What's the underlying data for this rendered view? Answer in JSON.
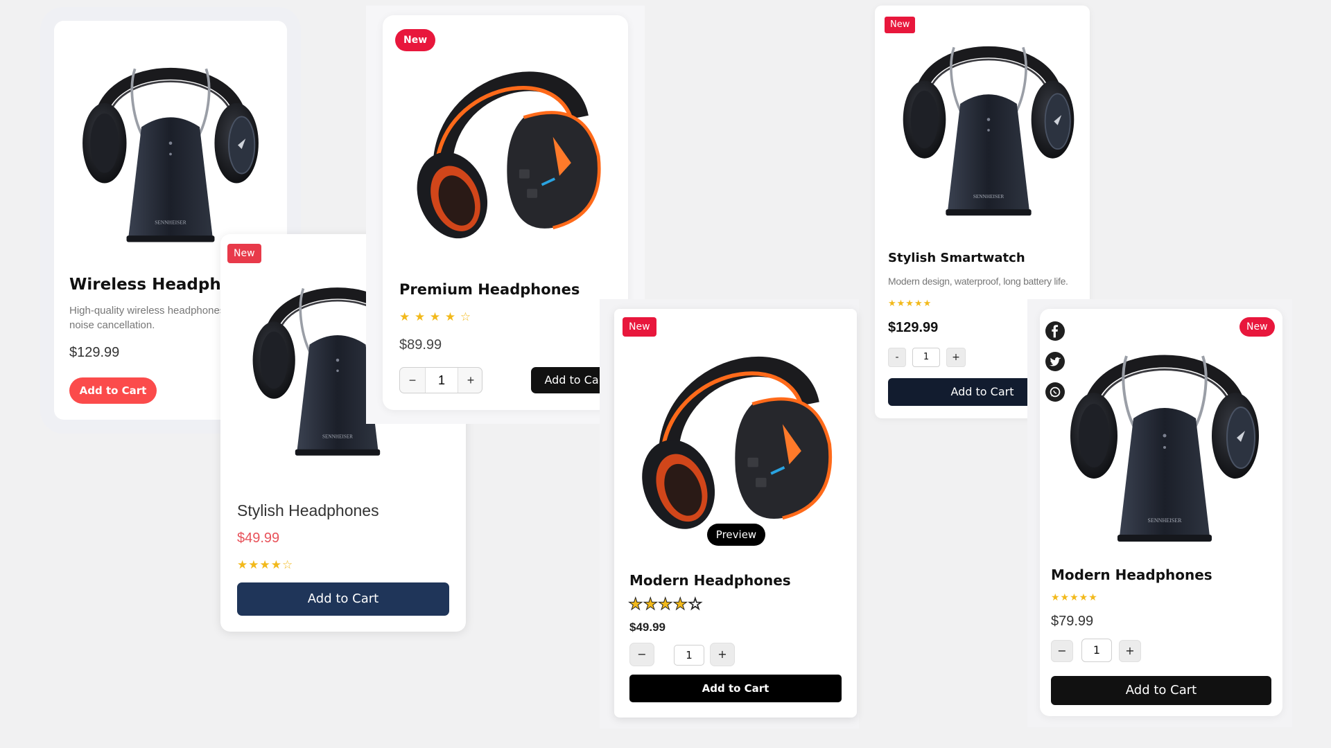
{
  "cards": {
    "wireless": {
      "title": "Wireless Headphones",
      "description_line1": "High-quality wireless headphones with",
      "description_line2": "noise cancellation.",
      "price": "$129.99",
      "cart_label": "Add to Cart",
      "icon": "headphones-stand-black"
    },
    "stylish": {
      "badge": "New",
      "title": "Stylish Headphones",
      "price": "$49.99",
      "stars": "★★★★☆",
      "rating": 4,
      "cart_label": "Add to Cart",
      "icon": "headphones-stand-black"
    },
    "premium": {
      "badge": "New",
      "title": "Premium Headphones",
      "stars": "★ ★ ★ ★ ☆",
      "rating": 4,
      "price": "$89.99",
      "qty_minus": "−",
      "qty_value": "1",
      "qty_plus": "+",
      "cart_label": "Add to Cart",
      "icon": "headphones-orange"
    },
    "modern1": {
      "badge": "New",
      "preview_label": "Preview",
      "title": "Modern Headphones",
      "stars": "★★★★☆",
      "rating": 4,
      "price": "$49.99",
      "qty_minus": "−",
      "qty_value": "1",
      "qty_plus": "+",
      "cart_label": "Add to Cart",
      "icon": "headphones-orange"
    },
    "smartwatch": {
      "badge": "New",
      "title": "Stylish Smartwatch",
      "description": "Modern design, waterproof, long battery life.",
      "stars": "★★★★★",
      "rating": 5,
      "price": "$129.99",
      "qty_minus": "-",
      "qty_value": "1",
      "qty_plus": "+",
      "cart_label": "Add to Cart",
      "icon": "headphones-stand-black"
    },
    "modern2": {
      "badge": "New",
      "social": [
        "facebook-icon",
        "twitter-icon",
        "whatsapp-icon"
      ],
      "title": "Modern Headphones",
      "stars": "★★★★★",
      "rating": 5,
      "price": "$79.99",
      "qty_minus": "−",
      "qty_value": "1",
      "qty_plus": "+",
      "cart_label": "Add to Cart",
      "icon": "headphones-stand-black"
    }
  },
  "colors": {
    "page_bg": "#f1f1f2",
    "coral": "#fb4b4b",
    "badge_red": "#e8173c",
    "navy": "#1f3559",
    "black": "#0a0a0a",
    "star": "#f2b91b",
    "orange": "#ff6a1a"
  }
}
